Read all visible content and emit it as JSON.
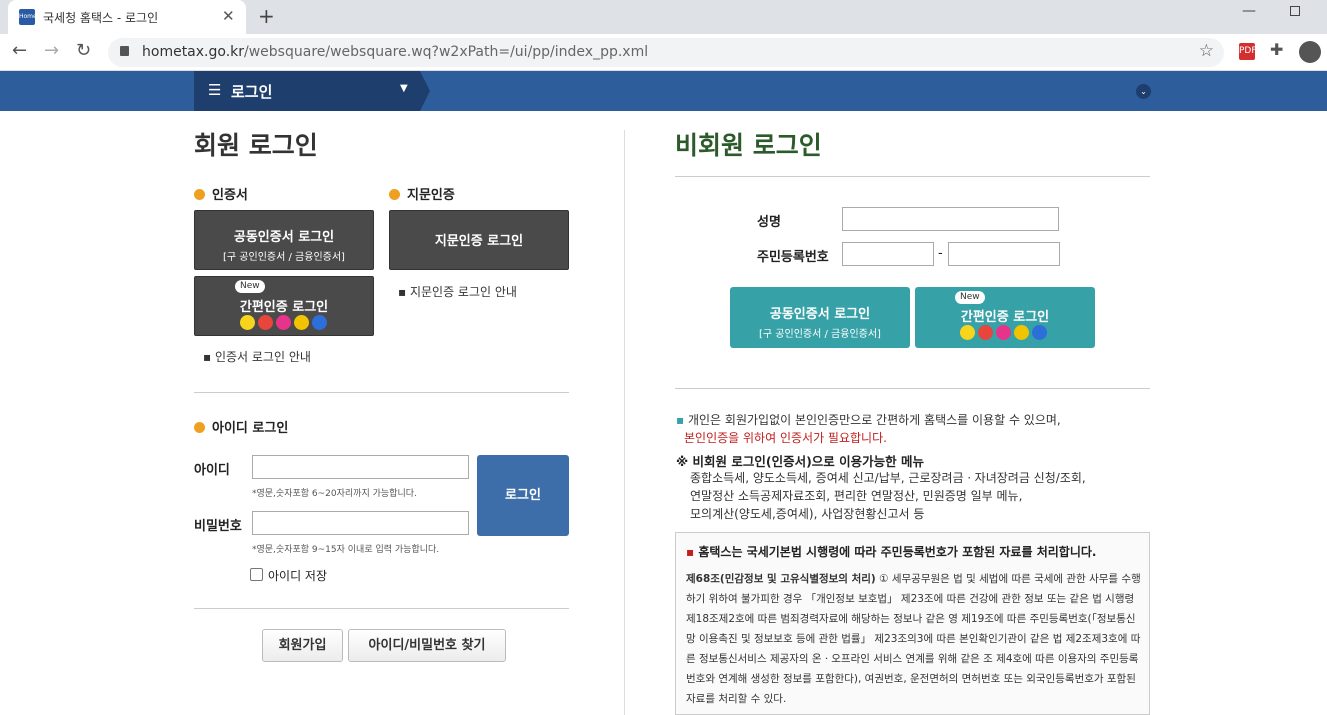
{
  "browser": {
    "tab_title": "국세청 홈택스 - 로그인",
    "favicon_text": "Hometax",
    "url_host": "hometax.go.kr",
    "url_path": "/websquare/websquare.wq?w2xPath=/ui/pp/index_pp.xml",
    "pdf_label": "PDF"
  },
  "nav": {
    "menu_title": "로그인"
  },
  "member": {
    "title": "회원 로그인",
    "cert_section": "인증서",
    "cert_btn_line1": "공동인증서 로그인",
    "cert_btn_line2": "[구 공인인증서 / 금융인증서]",
    "simple_badge": "New",
    "simple_btn": "간편인증 로그인",
    "cert_guide": "인증서 로그인 안내",
    "finger_section": "지문인증",
    "finger_btn": "지문인증 로그인",
    "finger_guide": "지문인증 로그인 안내",
    "id_section": "아이디 로그인",
    "id_label": "아이디",
    "id_hint": "*영문,숫자포함 6~20자리까지 가능합니다.",
    "pw_label": "비밀번호",
    "pw_hint": "*영문,숫자포함 9~15자 이내로 입력 가능합니다.",
    "login_btn": "로그인",
    "save_id": "아이디 저장",
    "join_btn": "회원가입",
    "find_btn": "아이디/비밀번호 찾기"
  },
  "guest": {
    "title": "비회원 로그인",
    "name_label": "성명",
    "rrn_label": "주민등록번호",
    "rrn_dash": "-",
    "cert_btn_line1": "공동인증서 로그인",
    "cert_btn_line2": "[구 공인인증서 / 금융인증서]",
    "simple_badge": "New",
    "simple_btn": "간편인증 로그인",
    "info1": "개인은 회원가입없이 본인인증만으로 간편하게 홈택스를 이용할 수 있으며,",
    "info1_red": "본인인증을 위하여 인증서가 필요합니다.",
    "menu_heading": "※ 비회원 로그인(인증서)으로 이용가능한 메뉴",
    "menu_lines": [
      "종합소득세, 양도소득세, 증여세 신고/납부, 근로장려금ㆍ자녀장려금 신청/조회,",
      "연말정산 소득공제자료조회, 편리한 연말정산, 민원증명 일부 메뉴,",
      "모의계산(양도세,증여세), 사업장현황신고서 등"
    ],
    "notice_title": "홈택스는 국세기본법 시행령에 따라 주민등록번호가 포함된 자료를 처리합니다.",
    "notice_bold": "제68조(민감정보 및 고유식별정보의 처리)",
    "notice_body": "① 세무공무원은 법 및 세법에 따른 국세에 관한 사무를 수행하기 위하여 불가피한 경우 「개인정보 보호법」 제23조에 따른 건강에 관한 정보 또는 같은 법 시행령 제18조제2호에 따른 범죄경력자료에 해당하는 정보나 같은 영 제19조에 따른 주민등록번호(「정보통신망 이용촉진 및 정보보호 등에 관한 법률」 제23조의3에 따른 본인확인기관이 같은 법 제2조제3호에 따른 정보통신서비스 제공자의 온ㆍ오프라인 서비스 연계를 위해 같은 조 제4호에 따른 이용자의 주민등록번호와 연계해 생성한 정보를 포함한다), 여권번호, 운전면허의 면허번호 또는 외국인등록번호가 포함된 자료를 처리할 수 있다."
  },
  "colors": {
    "navbar": "#2e5d9c",
    "teal": "#36a2a8",
    "guest_title": "#2d5a2a",
    "login_blue": "#3e6eaa"
  }
}
